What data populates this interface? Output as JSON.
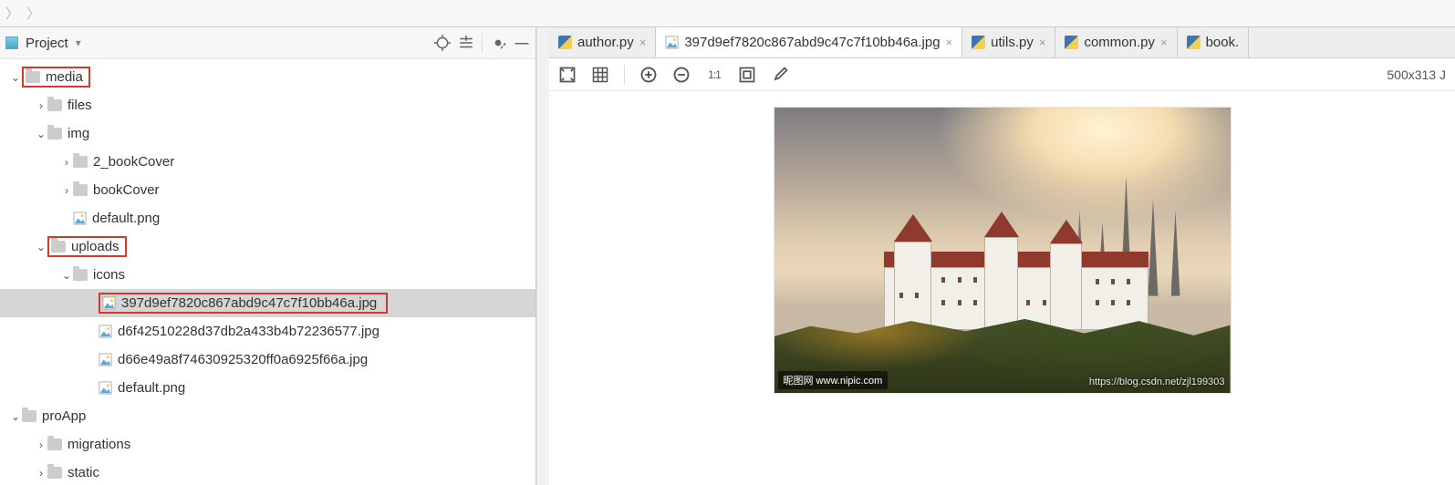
{
  "sidebar": {
    "title": "Project",
    "tree": {
      "media": "media",
      "files": "files",
      "img": "img",
      "bookCover2": "2_bookCover",
      "bookCover": "bookCover",
      "defaultPng1": "default.png",
      "uploads": "uploads",
      "icons": "icons",
      "f1": "397d9ef7820c867abd9c47c7f10bb46a.jpg",
      "f2": "d6f42510228d37db2a433b4b72236577.jpg",
      "f3": "d66e49a8f74630925320ff0a6925f66a.jpg",
      "defaultPng2": "default.png",
      "proApp": "proApp",
      "migrations": "migrations",
      "static": "static"
    }
  },
  "tabs": {
    "t0": "author.py",
    "t1": "397d9ef7820c867abd9c47c7f10bb46a.jpg",
    "t2": "utils.py",
    "t3": "common.py",
    "t4": "book."
  },
  "imgbar": {
    "oneToOne": "1:1",
    "dim": "500x313 J"
  },
  "photo": {
    "wm1": "昵图网  www.nipic.com",
    "wm2": "https://blog.csdn.net/zjl199303"
  }
}
